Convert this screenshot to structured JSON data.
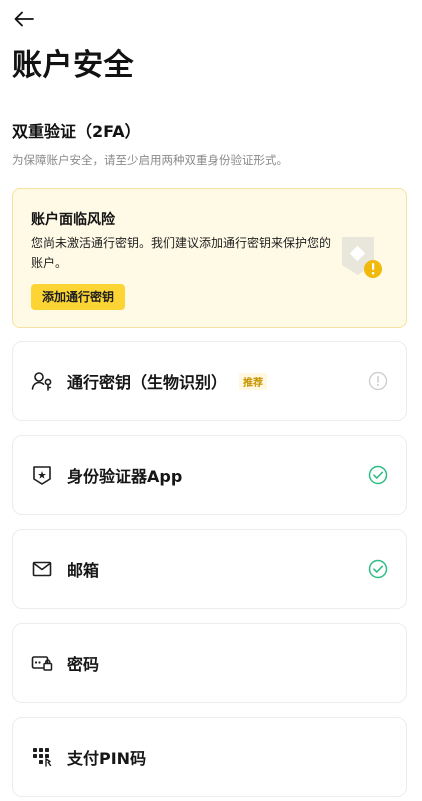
{
  "header": {
    "title": "账户安全"
  },
  "two_factor": {
    "title": "双重验证（2FA）",
    "description": "为保障账户安全，请至少启用两种双重身份验证形式。"
  },
  "risk_card": {
    "title": "账户面临风险",
    "description": "您尚未激活通行密钥。我们建议添加通行密钥来保护您的账户。",
    "button_label": "添加通行密钥"
  },
  "methods": [
    {
      "label": "通行密钥（生物识别）",
      "tag": "推荐",
      "icon": "passkey-icon",
      "status": "warning"
    },
    {
      "label": "身份验证器App",
      "icon": "authenticator-icon",
      "status": "enabled"
    },
    {
      "label": "邮箱",
      "icon": "email-icon",
      "status": "enabled"
    },
    {
      "label": "密码",
      "icon": "password-icon",
      "status": "none"
    },
    {
      "label": "支付PIN码",
      "icon": "pin-icon",
      "status": "none"
    }
  ],
  "colors": {
    "accent": "#fcd535",
    "risk_background": "#fffae6",
    "success": "#2ebd85",
    "warning_icon": "#f0b90b"
  }
}
